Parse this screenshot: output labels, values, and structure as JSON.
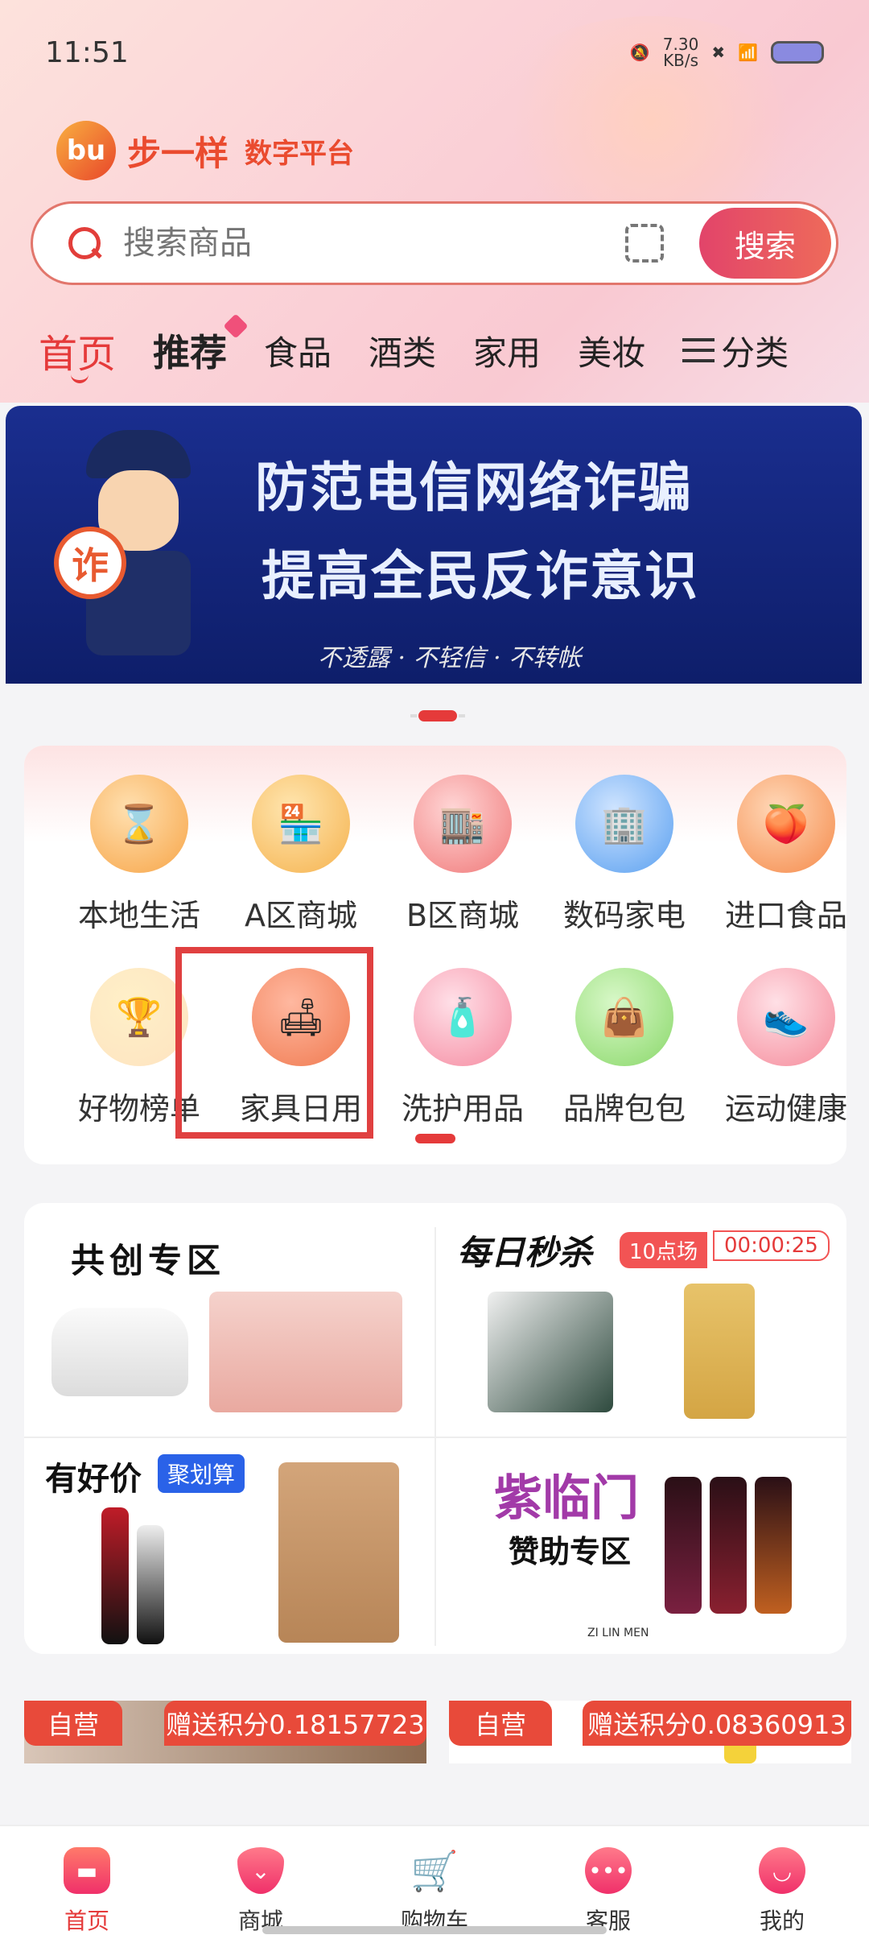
{
  "status": {
    "time": "11:51",
    "speed": "7.30",
    "speed_unit": "KB/s"
  },
  "header": {
    "logo_text": "步一样",
    "logo_sub": "数字平台"
  },
  "search": {
    "placeholder": "搜索商品",
    "button": "搜索"
  },
  "categories": [
    "首页",
    "推荐",
    "食品",
    "酒类",
    "家用",
    "美妆"
  ],
  "category_menu": "分类",
  "banner": {
    "line1": "防范电信网络诈骗",
    "line2": "提高全民反诈意识",
    "line3": "不透露 · 不轻信 · 不转帐",
    "seal": "诈"
  },
  "grid": [
    {
      "label": "本地生活",
      "icon": "local-life-icon",
      "color": "#f7a548"
    },
    {
      "label": "A区商城",
      "icon": "store-a-icon",
      "color": "#f5b24e"
    },
    {
      "label": "B区商城",
      "icon": "store-b-icon",
      "color": "#f07878"
    },
    {
      "label": "数码家电",
      "icon": "digital-store-icon",
      "color": "#5aa0f0"
    },
    {
      "label": "进口食品",
      "icon": "peach-icon",
      "color": "#f58a4a"
    },
    {
      "label": "好物榜单",
      "icon": "trophy-icon",
      "color": "#f5a030"
    },
    {
      "label": "家具日用",
      "icon": "sofa-icon",
      "color": "#f07a50"
    },
    {
      "label": "洗护用品",
      "icon": "cream-jar-icon",
      "color": "#f58aa0"
    },
    {
      "label": "品牌包包",
      "icon": "handbag-icon",
      "color": "#8ad86a"
    },
    {
      "label": "运动健康",
      "icon": "sneaker-icon",
      "color": "#f58a9a"
    }
  ],
  "promo": {
    "gongchuang": "共创专区",
    "miaosha": "每日秒杀",
    "miaosha_slot": "10点场",
    "miaosha_countdown": "00:00:25",
    "haojia": "有好价",
    "juhuasuan": "聚划算",
    "zilinmen": "紫临门",
    "zilinmen_sub": "赞助专区",
    "zilinmen_logo": "ZI LIN MEN"
  },
  "products": [
    {
      "tag": "自营",
      "points": "赠送积分0.18157723"
    },
    {
      "tag": "自营",
      "points": "赠送积分0.08360913"
    }
  ],
  "nav": [
    {
      "label": "首页",
      "icon": "home-icon",
      "active": true
    },
    {
      "label": "商城",
      "icon": "mall-icon",
      "active": false
    },
    {
      "label": "购物车",
      "icon": "cart-icon",
      "active": false
    },
    {
      "label": "客服",
      "icon": "chat-icon",
      "active": false
    },
    {
      "label": "我的",
      "icon": "profile-icon",
      "active": false
    }
  ],
  "colors": {
    "accent": "#e53a3a",
    "brand": "#ea4b2f",
    "banner": "#1a2e8f"
  }
}
